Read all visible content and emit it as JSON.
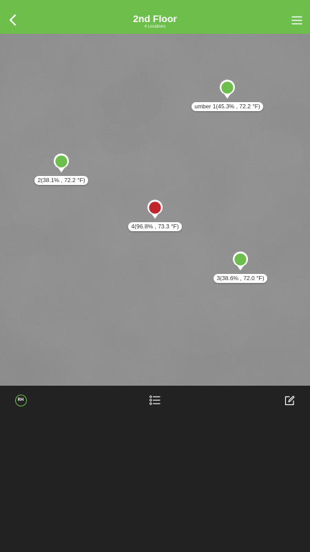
{
  "header": {
    "title": "2nd Floor",
    "subtitle": "4 Locations",
    "back_icon": "chevron-left-icon",
    "menu_icon": "hamburger-menu-icon",
    "background_color": "#6cbf4a"
  },
  "markers": [
    {
      "label": "umber 1(45.3% , 72.2 °F)",
      "status": "normal",
      "color": "#6cbf4a"
    },
    {
      "label": "2(38.1% , 72.2 °F)",
      "status": "normal",
      "color": "#6cbf4a"
    },
    {
      "label": "4(96.8% , 73.3 °F)",
      "status": "alert",
      "color": "#c0252e"
    },
    {
      "label": "3(38.6% , 72.0 °F)",
      "status": "normal",
      "color": "#6cbf4a"
    }
  ],
  "toolbar": {
    "rh_label": "RH",
    "list_icon": "list-icon",
    "edit_icon": "edit-icon",
    "accent_color": "#6cbf4a"
  }
}
